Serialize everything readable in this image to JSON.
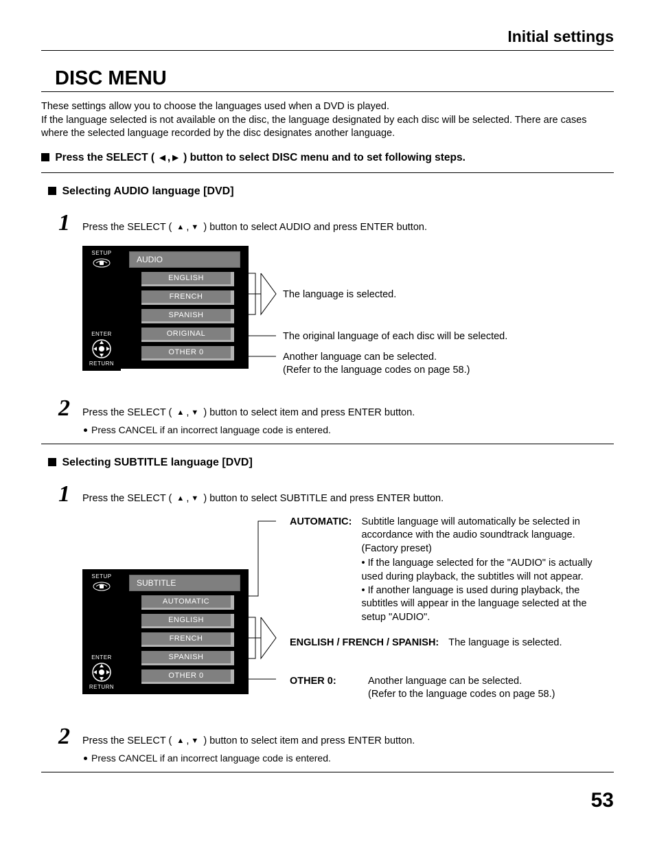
{
  "header": "Initial settings",
  "title": "DISC MENU",
  "intro1": "These settings allow you to choose the languages used when a DVD is played.",
  "intro2": "If the language selected is not available on the disc, the language designated by each disc will be selected. There are cases where the selected language recorded by the disc designates another language.",
  "press_line_a": "Press the SELECT (",
  "press_line_b": ") button to select DISC menu and to set following steps.",
  "audio": {
    "subhead": "Selecting AUDIO language [DVD]",
    "step1_a": "Press the SELECT (",
    "step1_b": ") button to select AUDIO and press ENTER button.",
    "menu_head": "AUDIO",
    "items": [
      "ENGLISH",
      "FRENCH",
      "SPANISH",
      "ORIGINAL",
      "OTHER  0"
    ],
    "anno_lang": "The language is selected.",
    "anno_orig": "The original language of each disc will be selected.",
    "anno_other1": "Another language can be selected.",
    "anno_other2": "(Refer to the language codes on page 58.)",
    "step2_a": "Press the SELECT (",
    "step2_b": ") button to select item and press ENTER button.",
    "note": "Press CANCEL if an incorrect language code is entered."
  },
  "subtitle": {
    "subhead": "Selecting SUBTITLE language [DVD]",
    "step1_a": "Press the SELECT (",
    "step1_b": ") button to select SUBTITLE and press ENTER button.",
    "menu_head": "SUBTITLE",
    "items": [
      "AUTOMATIC",
      "ENGLISH",
      "FRENCH",
      "SPANISH",
      "OTHER  0"
    ],
    "desc_auto_label": "AUTOMATIC:",
    "desc_auto_text": "Subtitle language will automatically be selected in accordance with the audio soundtrack language. (Factory preset)",
    "desc_auto_b1": "If the language selected for the \"AUDIO\" is actually used during playback, the subtitles will not appear.",
    "desc_auto_b2": "If another language is used during playback, the subtitles will appear in the language selected at the setup \"AUDIO\".",
    "desc_efs_label": "ENGLISH / FRENCH / SPANISH:",
    "desc_efs_text": "The language is selected.",
    "desc_other_label": "OTHER 0:",
    "desc_other_text1": "Another language can be selected.",
    "desc_other_text2": "(Refer to the language codes on page 58.)",
    "step2_a": "Press the SELECT (",
    "step2_b": ") button to select item and press ENTER button.",
    "note": "Press CANCEL if an incorrect language code is entered."
  },
  "remote": {
    "setup": "SETUP",
    "enter": "ENTER",
    "return": "RETURN"
  },
  "pagenum": "53"
}
